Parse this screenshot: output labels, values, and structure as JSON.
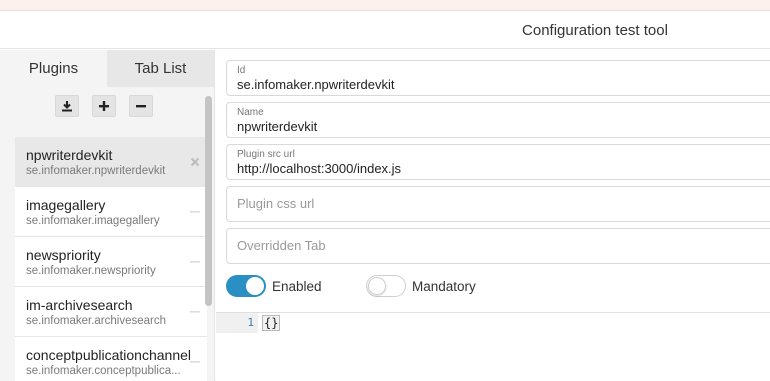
{
  "app": {
    "title": "Configuration test tool"
  },
  "sidebar": {
    "tabs": [
      {
        "label": "Plugins"
      },
      {
        "label": "Tab List"
      }
    ],
    "toolbar": {
      "download": "download-icon",
      "add": "plus-icon",
      "remove": "minus-icon"
    },
    "plugins": [
      {
        "name": "npwriterdevkit",
        "id": "se.infomaker.npwriterdevkit",
        "action": "close-icon"
      },
      {
        "name": "imagegallery",
        "id": "se.infomaker.imagegallery",
        "action": "minus-icon"
      },
      {
        "name": "newspriority",
        "id": "se.infomaker.newspriority",
        "action": "minus-icon"
      },
      {
        "name": "im-archivesearch",
        "id": "se.infomaker.archivesearch",
        "action": "minus-icon"
      },
      {
        "name": "conceptpublicationchannel",
        "id": "se.infomaker.conceptpublica...",
        "action": "minus-icon"
      }
    ]
  },
  "form": {
    "id": {
      "label": "Id",
      "value": "se.infomaker.npwriterdevkit"
    },
    "name": {
      "label": "Name",
      "value": "npwriterdevkit"
    },
    "src": {
      "label": "Plugin src url",
      "value": "http://localhost:3000/index.js"
    },
    "css": {
      "placeholder": "Plugin css url"
    },
    "tab": {
      "placeholder": "Overridden Tab"
    },
    "enabled": {
      "label": "Enabled",
      "on": true
    },
    "mandatory": {
      "label": "Mandatory",
      "on": false
    }
  },
  "editor": {
    "line_number": "1",
    "code": "{}"
  },
  "colors": {
    "accent": "#2a8fc2",
    "background_tint": "#fdf1ee"
  }
}
